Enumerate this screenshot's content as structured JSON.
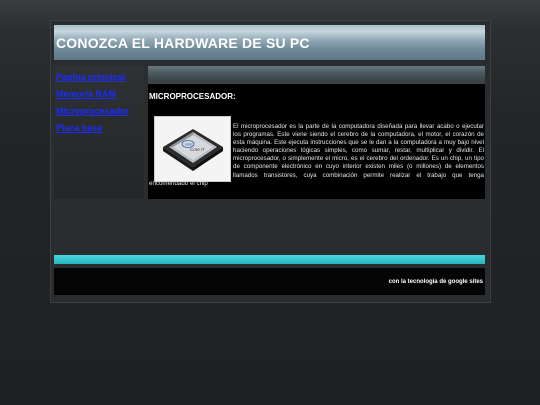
{
  "header": {
    "title": "CONOZCA EL HARDWARE DE SU PC"
  },
  "sidebar": {
    "items": [
      {
        "label": "Pagina principal"
      },
      {
        "label": "Memoria RAM"
      },
      {
        "label": "Microprocesador"
      },
      {
        "label": "Placa base"
      }
    ]
  },
  "main": {
    "title": "MICROPROCESADOR:",
    "image": {
      "brand_text": "intel",
      "model_text": "Core i7"
    },
    "paragraph": "El microprocesador es la parte de la computadora diseñada para llevar acabo o ejecutar los programas. Este viene siendo el cerebro de la computadora, el motor, el corazón de esta máquina. Este ejecuta instrucciones que se le dan a la computadora a muy bajo nivel haciendo operaciones lógicas simples, como sumar, restar, multiplicar y dividir. El microprocesador, o simplemente el micro, es el cerebro del ordenador. Es un chip, un tipo de componente electrónico en cuyo interior existen miles (o millones) de elementos llamados transistores, cuya combinación permite realizar el trabajo que tenga encomendado el chip"
  },
  "footer": {
    "text": "con la tecnología de google sites"
  },
  "colors": {
    "link": "#1a2cff",
    "accent_bar": "#2fbfc7",
    "header": "#7f98a6"
  }
}
